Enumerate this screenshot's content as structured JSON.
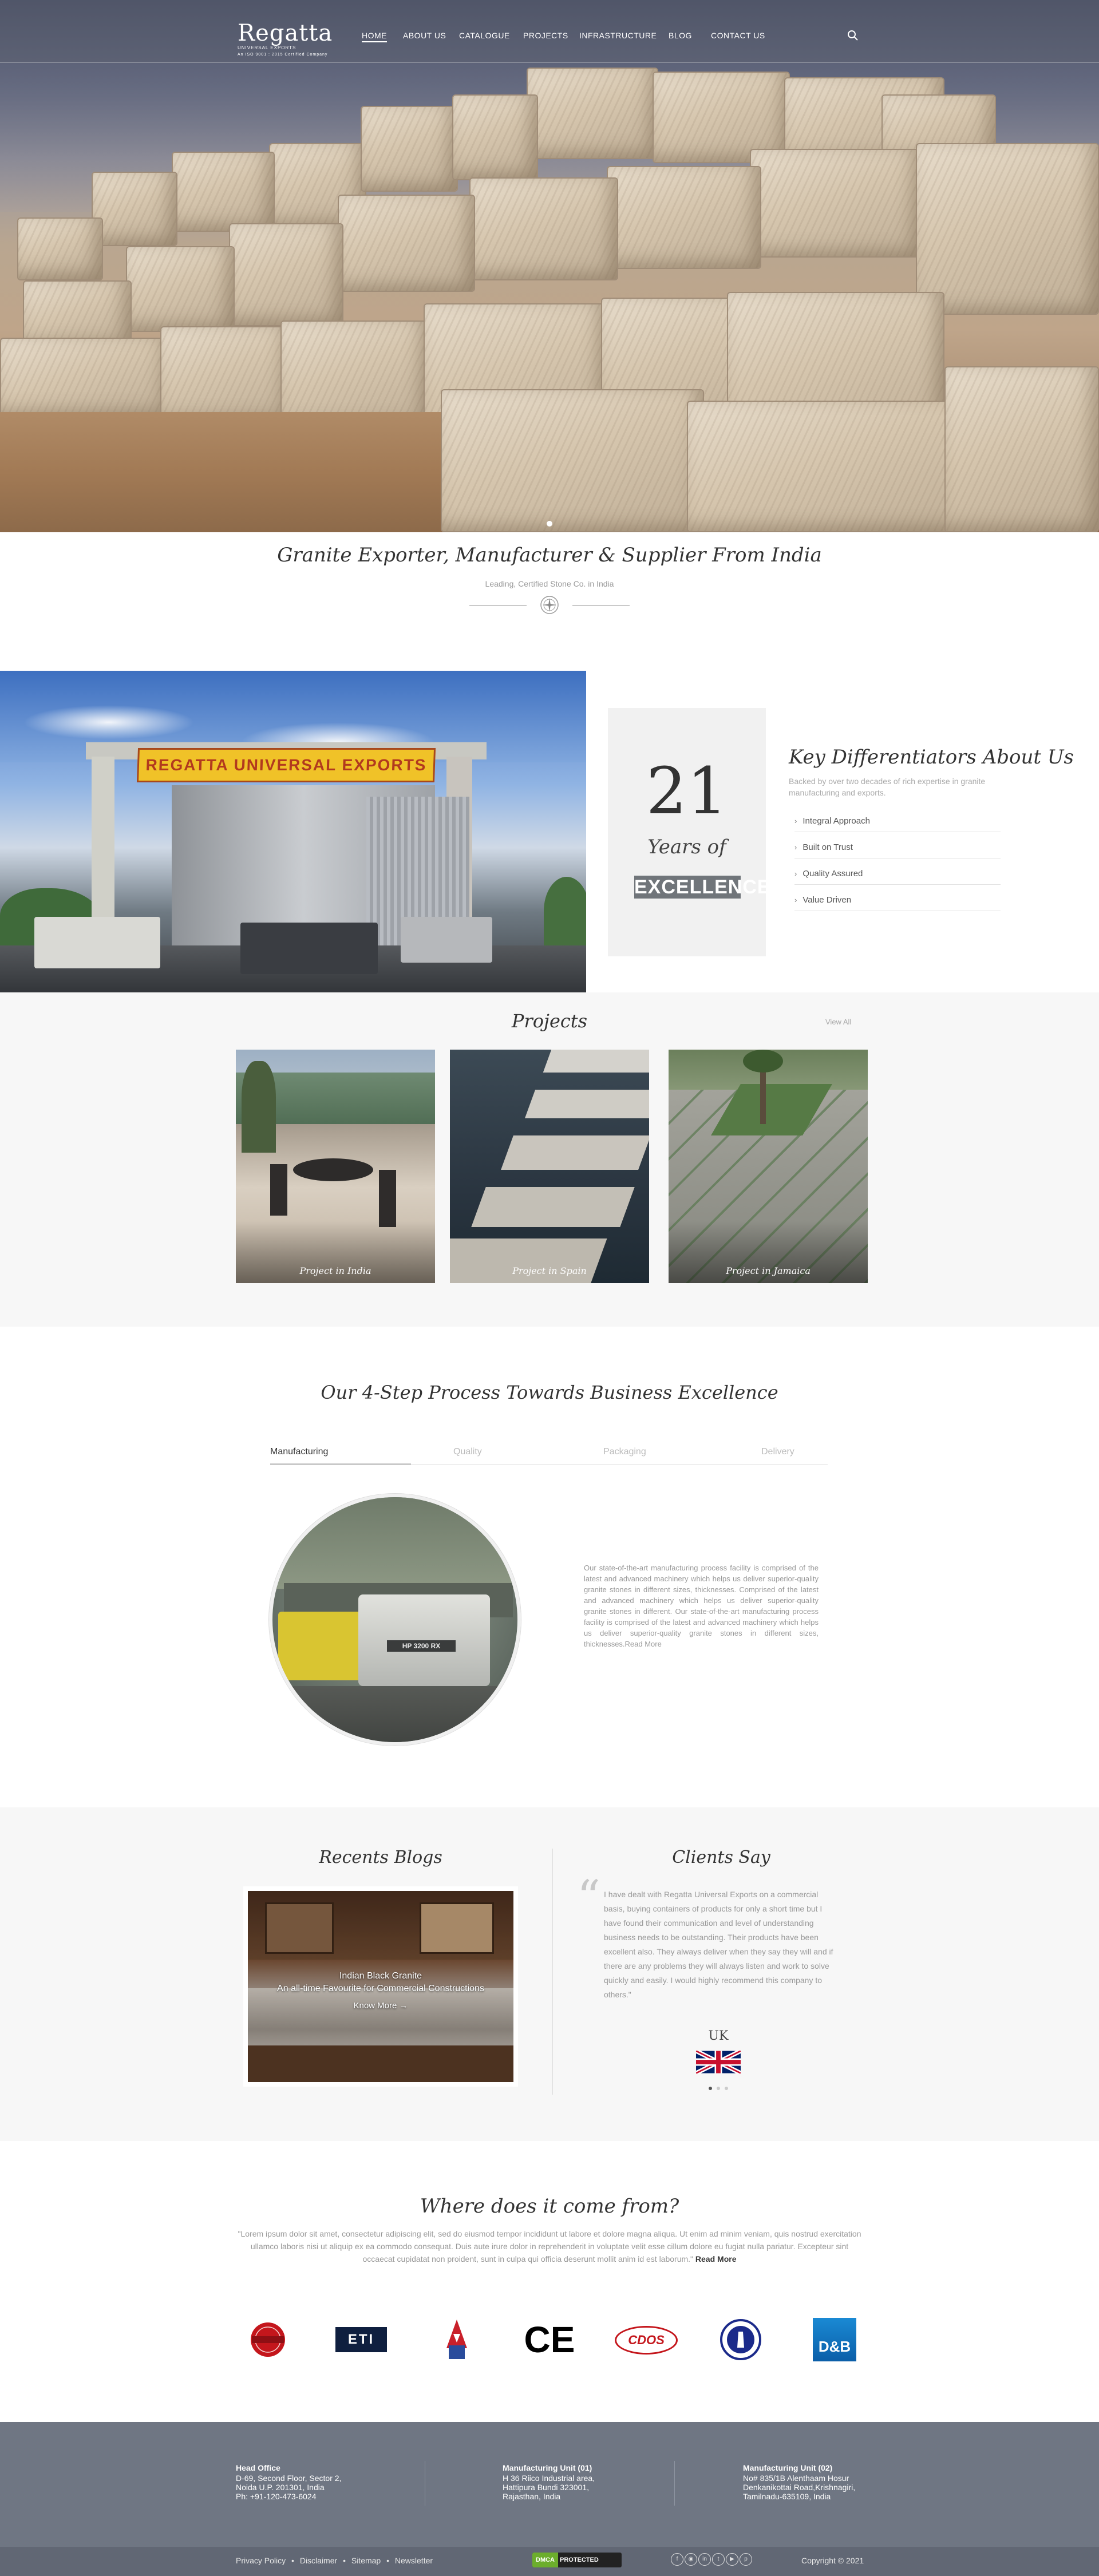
{
  "brand": {
    "name": "Regatta",
    "tagline_line1": "UNIVERSAL EXPORTS",
    "tagline_line2": "An ISO 9001 : 2015 Certified Company"
  },
  "nav": {
    "items": [
      "HOME",
      "ABOUT US",
      "CATALOGUE",
      "PROJECTS",
      "INFRASTRUCTURE",
      "BLOG",
      "CONTACT US"
    ],
    "active": "HOME"
  },
  "hero": {
    "icon": "search-icon"
  },
  "intro": {
    "title": "Granite Exporter, Manufacturer & Supplier From India",
    "subtitle": "Leading, Certified Stone Co. in India"
  },
  "about": {
    "factory_sign": "REGATTA UNIVERSAL EXPORTS",
    "years_number": "21",
    "years_label": "Years of",
    "years_badge": "EXCELLENCE",
    "title": "Key Differentiators About Us",
    "description": "Backed by over two decades of rich expertise in granite manufacturing and exports.",
    "items": [
      "Integral Approach",
      "Built on Trust",
      "Quality Assured",
      "Value Driven"
    ]
  },
  "projects": {
    "title": "Projects",
    "view_all": "View All",
    "cards": [
      "Project in India",
      "Project in Spain",
      "Project in Jamaica"
    ]
  },
  "process": {
    "title": "Our 4-Step Process Towards Business Excellence",
    "tabs": [
      "Manufacturing",
      "Quality",
      "Packaging",
      "Delivery"
    ],
    "active_tab": "Manufacturing",
    "machine_label": "HP 3200 RX",
    "text": "Our state-of-the-art manufacturing process facility is comprised of the latest and advanced machinery which helps us deliver superior-quality granite stones in different sizes, thicknesses. Comprised of the latest and advanced machinery which helps us deliver superior-quality granite stones in different. Our state-of-the-art manufacturing process facility is comprised of the latest and advanced machinery which helps us deliver superior-quality granite stones in different sizes, thicknesses.Read More"
  },
  "blogs": {
    "title": "Recents Blogs",
    "post_title": "Indian Black Granite",
    "post_excerpt": "An all-time Favourite for Commercial Constructions",
    "read_more": "Know More →"
  },
  "clients": {
    "title": "Clients Say",
    "quote": "I have dealt with Regatta Universal Exports on a commercial basis, buying containers of products for only a short time but I have found their communication and level of understanding business needs to be outstanding. Their products have been excellent also. They always deliver when they say they will and if there are any problems they will always listen and work to solve quickly and easily. I would highly recommend this company to others.\"",
    "country": "UK"
  },
  "where": {
    "title": "Where does it come from?",
    "text": "\"Lorem ipsum dolor sit amet, consectetur adipiscing elit, sed do eiusmod tempor incididunt ut labore et dolore magna aliqua. Ut enim ad minim veniam, quis nostrud exercitation ullamco laboris nisi ut aliquip ex ea commodo consequat. Duis aute irure dolor in reprehenderit in voluptate velit esse cillum dolore eu fugiat nulla pariatur. Excepteur sint occaecat cupidatat non proident, sunt in culpa qui officia deserunt mollit anim id est laborum.\"",
    "read_more": "Read More"
  },
  "certifications": {
    "logos": [
      "red-seal-logo",
      "eti-logo",
      "cgrade-logo",
      "ce-logo",
      "cdos-logo",
      "blue-circle-logo",
      "dnb-logo"
    ],
    "eti": "ETI",
    "ce": "CE",
    "cdos": "CDOS",
    "dnb": "D&B"
  },
  "footer": {
    "head_office": {
      "label": "Head Office",
      "lines": [
        "D-69, Second Floor, Sector 2,",
        "Noida U.P. 201301, India",
        "Ph: +91-120-473-6024"
      ]
    },
    "unit1": {
      "label": "Manufacturing Unit (01)",
      "lines": [
        "H 36 Riico Industrial area,",
        "Hattipura Bundi 323001,",
        "Rajasthan, India"
      ]
    },
    "unit2": {
      "label": "Manufacturing Unit (02)",
      "lines": [
        "No# 835/1B Alenthaam Hosur",
        "Denkanikottai Road,Krishnagiri,",
        "Tamilnadu-635109, India"
      ]
    },
    "links": [
      "Privacy Policy",
      "Disclaimer",
      "Sitemap",
      "Newsletter"
    ],
    "dmca_left": "DMCA",
    "dmca_right": "PROTECTED",
    "social_icons": [
      "facebook-icon",
      "instagram-icon",
      "linkedin-icon",
      "twitter-icon",
      "youtube-icon",
      "pinterest-icon"
    ],
    "copyright": "Copyright © 2021"
  },
  "colors": {
    "footer": "#6f7683",
    "section_grey": "#f7f7f7",
    "badge": "#70757a"
  }
}
